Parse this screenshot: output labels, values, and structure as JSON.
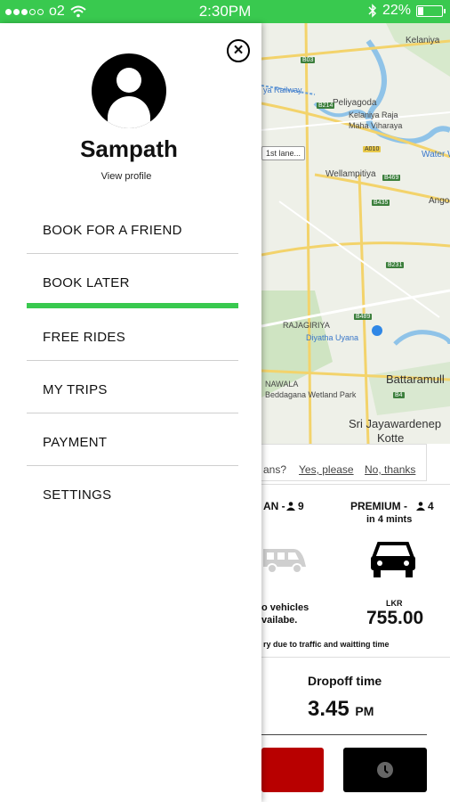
{
  "status_bar": {
    "carrier": "o2",
    "time": "2:30PM",
    "battery": "22%",
    "battery_level": 0.22
  },
  "map": {
    "labels": [
      "Kelaniya",
      "Peliyagoda",
      "Kelaniya Raja",
      "Maha Viharaya",
      "Wellampitiya",
      "Water W",
      "Angoc",
      "RAJAGIRIYA",
      "Diyatha Uyana",
      "NAWALA",
      "Beddagana Wetland Park",
      "Battaramull",
      "Sri Jayawardenep",
      "Kotte",
      "ya Railway"
    ],
    "chip": "1st lane..."
  },
  "booking": {
    "question": "ans?",
    "yes": "Yes, please",
    "no": "No, thanks",
    "van_label": "AN -",
    "van_capacity": "9",
    "van_status_1": "o vehicles",
    "van_status_2": "vailabe.",
    "premium_label": "PREMIUM -",
    "premium_capacity": "4",
    "premium_eta": "in 4 mints",
    "currency": "LKR",
    "price": "755.00",
    "delay_note": "ry due to traffic and waitting time",
    "dropoff_label": "Dropoff time",
    "dropoff_time": "3.45",
    "dropoff_ampm": "PM"
  },
  "drawer": {
    "user_name": "Sampath",
    "view_profile": "View profile",
    "menu": [
      {
        "label": "BOOK FOR A FRIEND"
      },
      {
        "label": "BOOK LATER"
      },
      {
        "label": "FREE RIDES"
      },
      {
        "label": "MY TRIPS"
      },
      {
        "label": "PAYMENT"
      },
      {
        "label": "SETTINGS"
      }
    ]
  },
  "colors": {
    "accent": "#39c94f",
    "danger": "#b80000"
  }
}
